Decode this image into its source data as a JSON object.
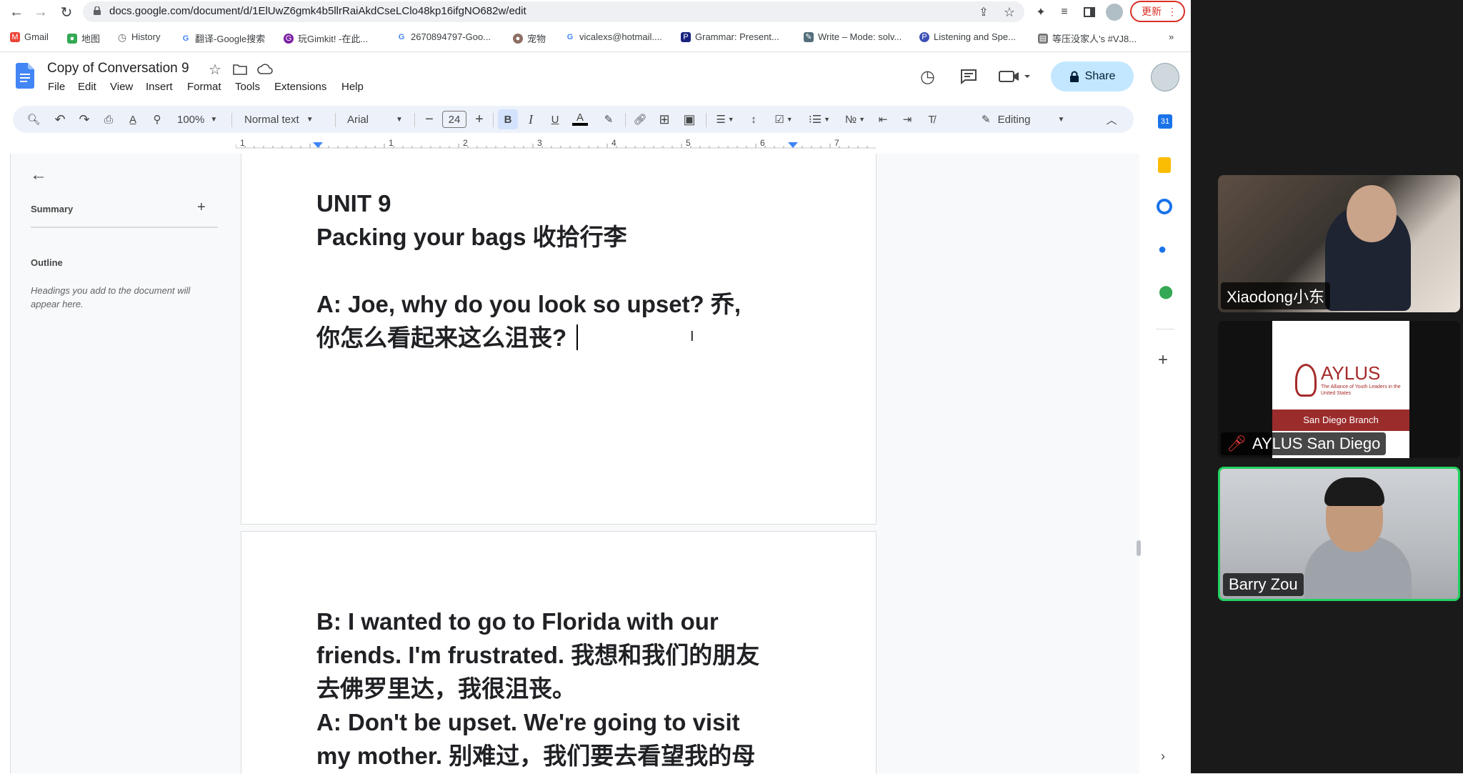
{
  "browser": {
    "url": "docs.google.com/document/d/1ElUwZ6gmk4b5llrRaiAkdCseLClo48kp16ifgNO682w/edit",
    "update_label": "更新",
    "bookmarks": [
      {
        "label": "Gmail",
        "color": "#ea4335"
      },
      {
        "label": "地图",
        "color": "#34a853"
      },
      {
        "label": "History",
        "color": "#5f6368"
      },
      {
        "label": "翻译-Google搜索",
        "color": "#4285f4"
      },
      {
        "label": "玩Gimkit! -在此...",
        "color": "#7b1fa2"
      },
      {
        "label": "2670894797-Goo...",
        "color": "#4285f4"
      },
      {
        "label": "宠物",
        "color": "#8d6e63"
      },
      {
        "label": "vicalexs@hotmail....",
        "color": "#4285f4"
      },
      {
        "label": "Grammar: Present...",
        "color": "#1a237e"
      },
      {
        "label": "Write – Mode: solv...",
        "color": "#546e7a"
      },
      {
        "label": "Listening and Spe...",
        "color": "#3f51b5"
      },
      {
        "label": "等压没家人's #VJ8...",
        "color": "#757575"
      }
    ],
    "more_label": "»"
  },
  "docs": {
    "title": "Copy of Conversation 9",
    "menu": [
      "File",
      "Edit",
      "View",
      "Insert",
      "Format",
      "Tools",
      "Extensions",
      "Help"
    ],
    "share_label": "Share",
    "toolbar": {
      "zoom": "100%",
      "style": "Normal text",
      "font": "Arial",
      "font_size": "24",
      "mode": "Editing"
    },
    "ruler_numbers": [
      "1",
      "1",
      "2",
      "3",
      "4",
      "5",
      "6",
      "7"
    ]
  },
  "left_panel": {
    "summary_label": "Summary",
    "outline_label": "Outline",
    "outline_hint_1": "Headings you add to the document will",
    "outline_hint_2": "appear here."
  },
  "document": {
    "page1": [
      "UNIT 9",
      "Packing your bags 收拾行李",
      "",
      "A: Joe, why do you look so upset? 乔,",
      "你怎么看起来这么沮丧?"
    ],
    "page2": [
      "B: I wanted to go to Florida with our",
      "friends. I'm frustrated. 我想和我们的朋友",
      "去佛罗里达，我很沮丧。",
      "A: Don't be upset. We're going to visit",
      "my mother. 别难过，我们要去看望我的母"
    ]
  },
  "participants": [
    {
      "name": "Xiaodong小东",
      "muted": false
    },
    {
      "name": "AYLUS San Diego",
      "muted": true,
      "logo_title": "AYLUS",
      "logo_sub": "The Alliance of Youth Leaders in the United States",
      "logo_branch": "San Diego Branch"
    },
    {
      "name": "Barry Zou",
      "muted": false,
      "active": true
    }
  ]
}
